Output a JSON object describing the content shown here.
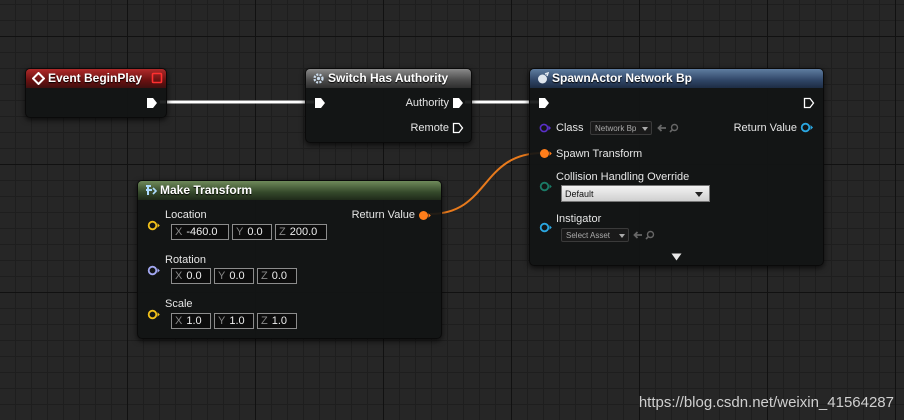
{
  "event_node": {
    "title": "Event BeginPlay"
  },
  "switch_node": {
    "title": "Switch Has Authority",
    "authority_label": "Authority",
    "remote_label": "Remote"
  },
  "spawn_node": {
    "title": "SpawnActor Network Bp",
    "class_label": "Class",
    "class_value": "Network Bp",
    "return_label": "Return Value",
    "spawn_transform_label": "Spawn Transform",
    "collision_label": "Collision Handling Override",
    "collision_value": "Default",
    "instigator_label": "Instigator",
    "instigator_value": "Select Asset"
  },
  "make_transform_node": {
    "title": "Make Transform",
    "return_label": "Return Value",
    "location": {
      "label": "Location",
      "x": "-460.0",
      "y": "0.0",
      "z": "200.0"
    },
    "rotation": {
      "label": "Rotation",
      "x": "0.0",
      "y": "0.0",
      "z": "0.0"
    },
    "scale": {
      "label": "Scale",
      "x": "1.0",
      "y": "1.0",
      "z": "1.0"
    }
  },
  "axes": {
    "x": "X",
    "y": "Y",
    "z": "Z"
  },
  "watermark": "https://blog.csdn.net/weixin_41564287",
  "colors": {
    "exec": "#ffffff",
    "object_pin": "#3b1f8f",
    "struct_pin": "#ff7d1a",
    "vector_pin": "#f2c11a",
    "rotator_pin": "#a3a8f2",
    "enum_pin": "#1a6a5a",
    "actor_pin": "#2aa6e0"
  }
}
